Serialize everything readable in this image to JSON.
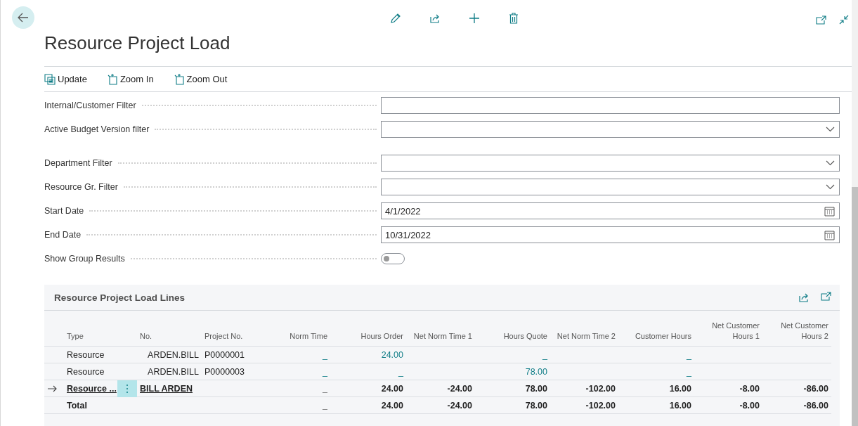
{
  "page": {
    "title": "Resource Project Load"
  },
  "actions": [
    {
      "label": "Update",
      "kind": "update"
    },
    {
      "label": "Zoom In",
      "kind": "zoom"
    },
    {
      "label": "Zoom Out",
      "kind": "zoom"
    }
  ],
  "field_groups": [
    {
      "fields": [
        {
          "label": "Internal/Customer Filter",
          "kind": "text"
        },
        {
          "label": "Active Budget Version filter",
          "kind": "dropdown"
        }
      ]
    },
    {
      "fields": [
        {
          "label": "Department Filter",
          "kind": "dropdown"
        },
        {
          "label": "Resource Gr. Filter",
          "kind": "dropdown"
        },
        {
          "label": "Start Date",
          "kind": "date",
          "value": "4/1/2022"
        },
        {
          "label": "End Date",
          "kind": "date",
          "value": "10/31/2022"
        },
        {
          "label": "Show Group Results",
          "kind": "toggle",
          "on": false
        }
      ]
    }
  ],
  "table": {
    "title": "Resource Project Load Lines",
    "columns": [
      "Type",
      "No.",
      "Project No.",
      "Norm Time",
      "Hours Order",
      "Net Norm Time 1",
      "Hours Quote",
      "Net Norm Time 2",
      "Customer Hours",
      "Net Customer Hours 1",
      "Net Customer Hours 2"
    ],
    "rows": [
      {
        "kind": "line",
        "selected": false,
        "cells": [
          "Resource",
          "ARDEN.BILL",
          "P0000001",
          "_",
          "24.00",
          null,
          "_",
          null,
          "_",
          null,
          null
        ]
      },
      {
        "kind": "line",
        "selected": false,
        "cells": [
          "Resource",
          "ARDEN.BILL",
          "P0000003",
          "_",
          "_",
          null,
          "78.00",
          null,
          "_",
          null,
          null
        ]
      },
      {
        "kind": "group",
        "selected": true,
        "cells": [
          "Resource ...",
          "BILL ARDEN",
          null,
          "_",
          "24.00",
          "-24.00",
          "78.00",
          "-102.00",
          "16.00",
          "-8.00",
          "-86.00"
        ]
      },
      {
        "kind": "total",
        "selected": false,
        "cells": [
          "Total",
          null,
          null,
          "_",
          "24.00",
          "-24.00",
          "78.00",
          "-102.00",
          "16.00",
          "-8.00",
          "-86.00"
        ]
      }
    ]
  }
}
